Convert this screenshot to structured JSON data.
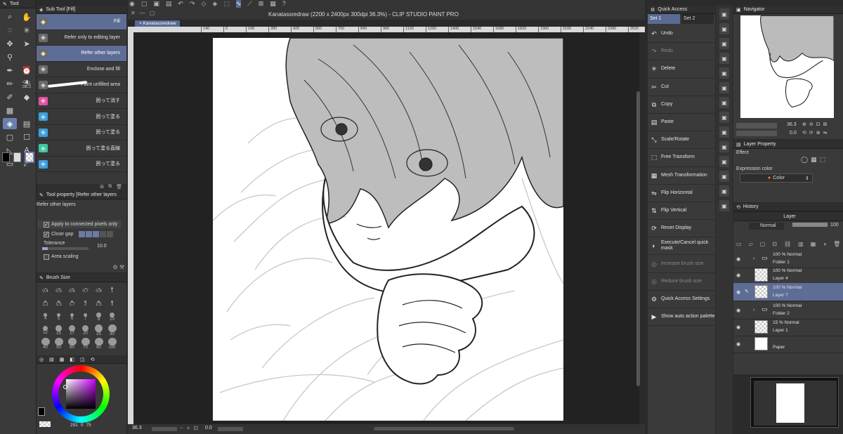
{
  "app": {
    "title": "Kanatassredraw (2200 x 2400px 300dpi 36.3%) - CLIP STUDIO PAINT PRO",
    "doc_tab": "Kanatassredraw"
  },
  "toolbar": {
    "header": "Tool"
  },
  "subtool": {
    "header": "Sub Tool [Fill]",
    "items": [
      {
        "label": "Fill",
        "color": "#6a6a6a",
        "selected": true
      },
      {
        "label": "Refer only to editing layer",
        "color": "#6a6a6a",
        "selected": false
      },
      {
        "label": "Refer other layers",
        "color": "#6a6a6a",
        "selected": true
      },
      {
        "label": "Enclose and fill",
        "color": "#6a6a6a",
        "selected": false
      },
      {
        "label": "Paint unfilled area",
        "color": "#6a6a6a",
        "selected": false
      },
      {
        "label": "囲って消す",
        "color": "#e84fa0",
        "selected": false
      },
      {
        "label": "囲って塗る",
        "color": "#3aa0e0",
        "selected": false
      },
      {
        "label": "囲って塗る",
        "color": "#3aa0e0",
        "selected": false
      },
      {
        "label": "囲って塗る直線",
        "color": "#3acaa0",
        "selected": false
      },
      {
        "label": "囲って塗る",
        "color": "#3aa0e0",
        "selected": false
      }
    ]
  },
  "toolprop": {
    "header": "Tool property [Refer other layers",
    "subheader": "Refer other layers",
    "apply_connected": "Apply to connected pixels only",
    "close_gap": "Close gap",
    "tolerance_label": "Tolerance",
    "tolerance_value": "10.0",
    "area_scaling": "Area scaling"
  },
  "brushsize": {
    "header": "Brush Size",
    "sizes": [
      "0.4",
      "0.5",
      "0.6",
      "0.7",
      "0.8",
      "1",
      "1.2",
      "1.5",
      "1.7",
      "2",
      "2.5",
      "3",
      "4",
      "5",
      "6",
      "7",
      "8",
      "10",
      "12",
      "15",
      "17",
      "20",
      "25",
      "30",
      "40",
      "50",
      "60",
      "70",
      "80",
      "100"
    ]
  },
  "color": {
    "value_a": "291",
    "value_b": "0",
    "value_c": "75"
  },
  "canvas": {
    "zoom": "36.3",
    "rotation": "0.0",
    "ruler_marks": [
      "140",
      "0",
      "140",
      "280",
      "420",
      "560",
      "700",
      "840",
      "980",
      "1120",
      "1260",
      "1400",
      "1540",
      "1680",
      "1820",
      "1960",
      "2100",
      "2240",
      "2380",
      "2520"
    ]
  },
  "quick_access": {
    "header": "Quick Access",
    "tabs": [
      "Set 1",
      "Set 2"
    ],
    "items": [
      {
        "label": "Undo",
        "icon": "undo-icon",
        "enabled": true
      },
      {
        "label": "Redo",
        "icon": "redo-icon",
        "enabled": false
      },
      {
        "label": "Delete",
        "icon": "delete-icon",
        "enabled": true
      },
      {
        "label": "Cut",
        "icon": "cut-icon",
        "enabled": true
      },
      {
        "label": "Copy",
        "icon": "copy-icon",
        "enabled": true
      },
      {
        "label": "Paste",
        "icon": "paste-icon",
        "enabled": true
      },
      {
        "label": "Scale/Rotate",
        "icon": "scale-icon",
        "enabled": true
      },
      {
        "label": "Free Transform",
        "icon": "transform-icon",
        "enabled": true
      },
      {
        "label": "Mesh Transformation",
        "icon": "mesh-icon",
        "enabled": true
      },
      {
        "label": "Flip Horizontal",
        "icon": "flip-h-icon",
        "enabled": true
      },
      {
        "label": "Flip Vertical",
        "icon": "flip-v-icon",
        "enabled": true
      },
      {
        "label": "Reset Display",
        "icon": "reset-icon",
        "enabled": true
      },
      {
        "label": "Execute/Cancel quick mask",
        "icon": "mask-icon",
        "enabled": true
      },
      {
        "label": "Increase brush size",
        "icon": "brush-up-icon",
        "enabled": false
      },
      {
        "label": "Reduce brush size",
        "icon": "brush-down-icon",
        "enabled": false
      },
      {
        "label": "Quick Access Settings",
        "icon": "settings-icon",
        "enabled": true
      },
      {
        "label": "Show auto action palette",
        "icon": "action-icon",
        "enabled": true
      }
    ]
  },
  "navigator": {
    "header": "Navigator",
    "zoom": "36.3",
    "rotate": "0.0"
  },
  "layer_property": {
    "header": "Layer Property",
    "effect": "Effect",
    "expression_label": "Expression color",
    "expression_value": "Color"
  },
  "history": {
    "header": "History"
  },
  "layers": {
    "header": "Layer",
    "blend": "Normal",
    "opacity": "100",
    "items": [
      {
        "mode": "100 % Normal",
        "name": "Folder 1",
        "kind": "folder",
        "selected": false
      },
      {
        "mode": "100 % Normal",
        "name": "Layer 4",
        "kind": "layer",
        "selected": false
      },
      {
        "mode": "100 % Normal",
        "name": "Layer 7",
        "kind": "layer",
        "selected": true
      },
      {
        "mode": "100 % Normal",
        "name": "Folder 2",
        "kind": "folder",
        "selected": false
      },
      {
        "mode": "15 % Normal",
        "name": "Layer 1",
        "kind": "layer",
        "selected": false
      },
      {
        "mode": "",
        "name": "Paper",
        "kind": "paper",
        "selected": false
      }
    ]
  }
}
